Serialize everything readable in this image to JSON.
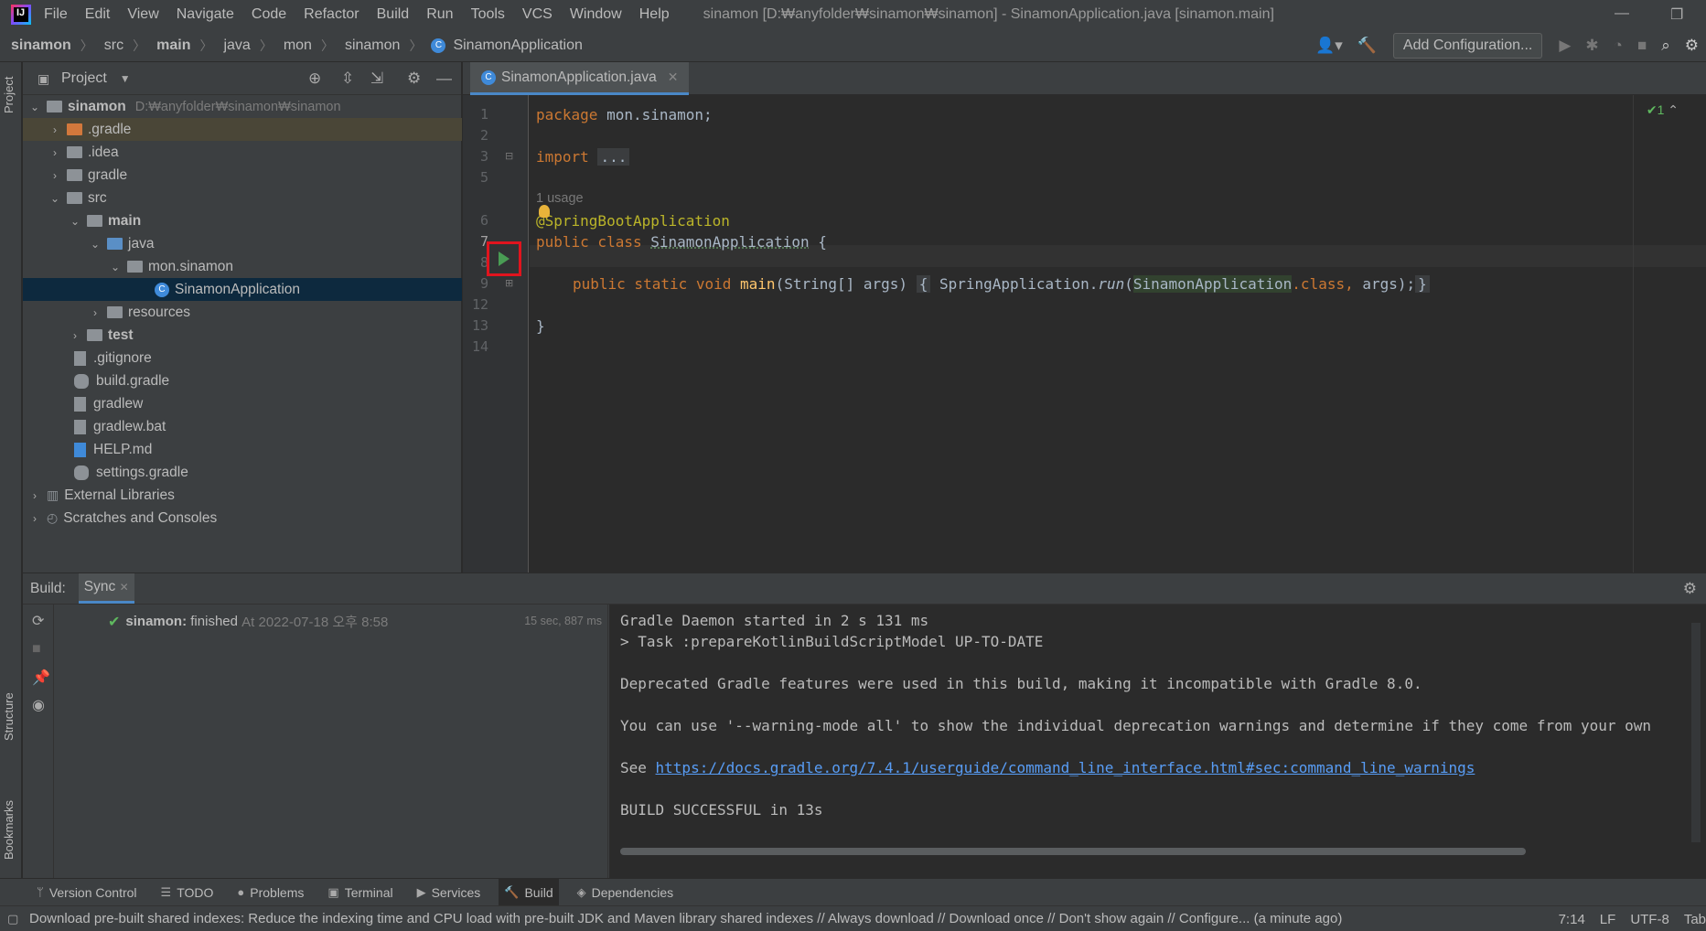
{
  "menubar": {
    "items": [
      "File",
      "Edit",
      "View",
      "Navigate",
      "Code",
      "Refactor",
      "Build",
      "Run",
      "Tools",
      "VCS",
      "Window",
      "Help"
    ],
    "window_title": "sinamon [D:₩anyfolder₩sinamon₩sinamon] - SinamonApplication.java [sinamon.main]"
  },
  "navbar": {
    "breadcrumbs": [
      "sinamon",
      "src",
      "main",
      "java",
      "mon",
      "sinamon",
      "SinamonApplication"
    ],
    "add_configuration": "Add Configuration..."
  },
  "left_strip": {
    "project": "Project",
    "structure": "Structure",
    "bookmarks": "Bookmarks"
  },
  "project_panel": {
    "title": "Project",
    "root_name": "sinamon",
    "root_path": "D:₩anyfolder₩sinamon₩sinamon",
    "tree": [
      ".gradle",
      ".idea",
      "gradle",
      "src",
      "main",
      "java",
      "mon.sinamon",
      "SinamonApplication",
      "resources",
      "test",
      ".gitignore",
      "build.gradle",
      "gradlew",
      "gradlew.bat",
      "HELP.md",
      "settings.gradle",
      "External Libraries",
      "Scratches and Consoles"
    ]
  },
  "editor": {
    "tab_label": "SinamonApplication.java",
    "line_numbers": [
      "1",
      "2",
      "3",
      "5",
      "6",
      "7",
      "8",
      "9",
      "12",
      "13",
      "14"
    ],
    "code": {
      "l1_kw": "package",
      "l1_rest": " mon.sinamon;",
      "l3_kw": "import",
      "l3_fold": "...",
      "usage_hint": "1 usage",
      "l6": "@SpringBootApplication",
      "l7_kw": "public class ",
      "l7_name": "SinamonApplication",
      "l7_rest": " {",
      "l9_kw": "public static void ",
      "l9_fn": "main",
      "l9_args": "(String[] args) ",
      "l9_fold_open": "{",
      "l9_call": " SpringApplication.",
      "l9_run": "run",
      "l9_paren": "(",
      "l9_ref": "SinamonApplication",
      "l9_cls": ".class, ",
      "l9_end": "args);",
      "l9_fold_close": "}",
      "l13": "}"
    },
    "inspection": "✔1"
  },
  "build_panel": {
    "label": "Build:",
    "sync_tab": "Sync",
    "row_project": "sinamon:",
    "row_status": "finished",
    "row_at": "At 2022-07-18 오후 8:58",
    "row_time": "15 sec, 887 ms",
    "console": {
      "l1": "Gradle Daemon started in 2 s 131 ms",
      "l2": "> Task :prepareKotlinBuildScriptModel UP-TO-DATE",
      "l3": "Deprecated Gradle features were used in this build, making it incompatible with Gradle 8.0.",
      "l4": "You can use '--warning-mode all' to show the individual deprecation warnings and determine if they come from your own",
      "l5_prefix": "See ",
      "l5_link": "https://docs.gradle.org/7.4.1/userguide/command_line_interface.html#sec:command_line_warnings",
      "l6": "BUILD SUCCESSFUL in 13s"
    }
  },
  "bottom_tabs": [
    "Version Control",
    "TODO",
    "Problems",
    "Terminal",
    "Services",
    "Build",
    "Dependencies"
  ],
  "status_bar": {
    "message": "Download pre-built shared indexes: Reduce the indexing time and CPU load with pre-built JDK and Maven library shared indexes // Always download // Download once // Don't show again // Configure... (a minute ago)",
    "position": "7:14",
    "line_sep": "LF",
    "encoding": "UTF-8",
    "indent": "Tab"
  }
}
